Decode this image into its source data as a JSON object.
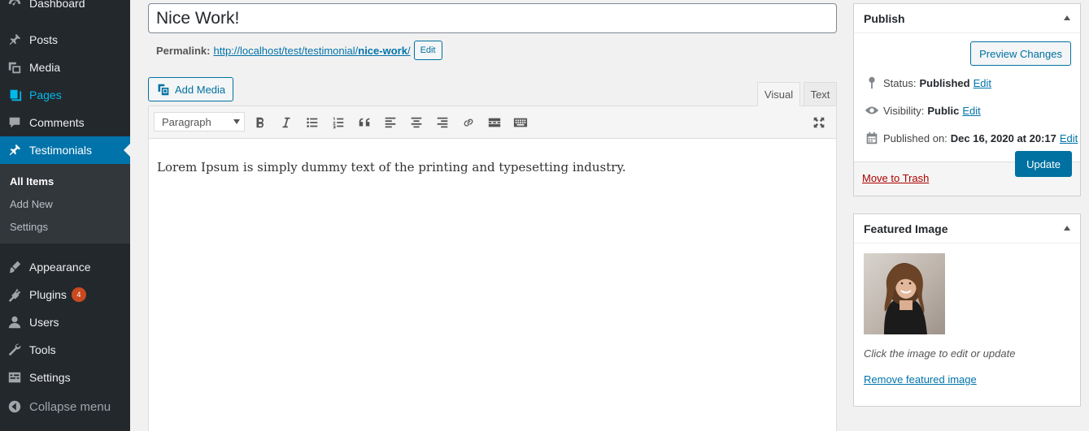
{
  "sidebar": {
    "items": [
      {
        "label": "Dashboard",
        "icon": "dashboard-icon"
      },
      {
        "label": "Posts",
        "icon": "pushpin-icon"
      },
      {
        "label": "Media",
        "icon": "media-icon"
      },
      {
        "label": "Pages",
        "icon": "pages-icon"
      },
      {
        "label": "Comments",
        "icon": "comment-icon"
      },
      {
        "label": "Testimonials",
        "icon": "pushpin-icon"
      },
      {
        "label": "Appearance",
        "icon": "paintbrush-icon"
      },
      {
        "label": "Plugins",
        "icon": "plugin-icon",
        "badge": "4"
      },
      {
        "label": "Users",
        "icon": "users-icon"
      },
      {
        "label": "Tools",
        "icon": "wrench-icon"
      },
      {
        "label": "Settings",
        "icon": "settings-icon"
      }
    ],
    "submenu": [
      "All Items",
      "Add New",
      "Settings"
    ],
    "collapse_label": "Collapse menu"
  },
  "editor": {
    "title": "Nice Work!",
    "permalink_label": "Permalink:",
    "permalink_base": "http://localhost/test/testimonial/",
    "permalink_slug": "nice-work",
    "permalink_tail": "/",
    "permalink_edit": "Edit",
    "add_media": "Add Media",
    "tab_visual": "Visual",
    "tab_text": "Text",
    "format": "Paragraph",
    "content": "Lorem Ipsum is simply dummy text of the printing and typesetting industry."
  },
  "publish": {
    "title": "Publish",
    "preview": "Preview Changes",
    "status_label": "Status:",
    "status_value": "Published",
    "visibility_label": "Visibility:",
    "visibility_value": "Public",
    "published_label": "Published on:",
    "published_value": "Dec 16, 2020 at 20:17",
    "edit": "Edit",
    "trash": "Move to Trash",
    "update": "Update"
  },
  "featured": {
    "title": "Featured Image",
    "hint": "Click the image to edit or update",
    "remove": "Remove featured image"
  },
  "colors": {
    "sidebar_bg": "#23282d",
    "active": "#0073aa",
    "link": "#0073aa",
    "badge": "#ca4a1f",
    "trash": "#aa0000"
  }
}
